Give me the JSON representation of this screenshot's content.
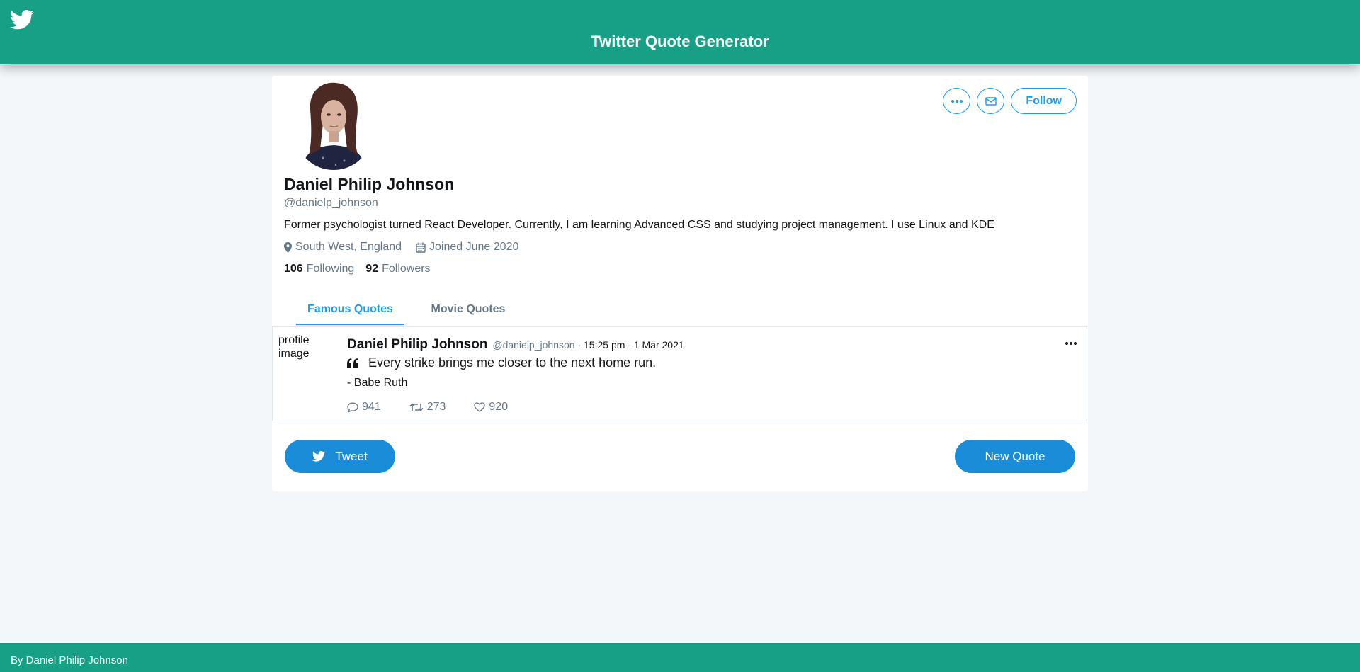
{
  "header": {
    "title": "Twitter Quote Generator",
    "logo_icon": "twitter-bird-icon"
  },
  "profile": {
    "name": "Daniel Philip Johnson",
    "handle": "@danielp_johnson",
    "bio": "Former psychologist turned React Developer. Currently, I am learning Advanced CSS and studying project management. I use Linux and KDE",
    "location": "South West, England",
    "joined": "Joined June 2020",
    "following_count": "106",
    "following_label": "Following",
    "followers_count": "92",
    "followers_label": "Followers",
    "follow_label": "Follow"
  },
  "tabs": [
    {
      "label": "Famous Quotes",
      "active": true
    },
    {
      "label": "Movie Quotes",
      "active": false
    }
  ],
  "tweet": {
    "profile_image_alt": "profile image",
    "name": "Daniel Philip Johnson",
    "handle": "@danielp_johnson",
    "separator": "·",
    "time": "15:25 pm - 1 Mar 2021",
    "quote": "Every strike brings me closer to the next home run.",
    "author": "- Babe Ruth",
    "replies": "941",
    "retweets": "273",
    "likes": "920"
  },
  "buttons": {
    "tweet_label": "Tweet",
    "new_quote_label": "New Quote"
  },
  "footer": {
    "text": "By Daniel Philip Johnson"
  },
  "colors": {
    "brand": "#17a085",
    "accent": "#1d9bf0",
    "button": "#1a8cd8"
  }
}
